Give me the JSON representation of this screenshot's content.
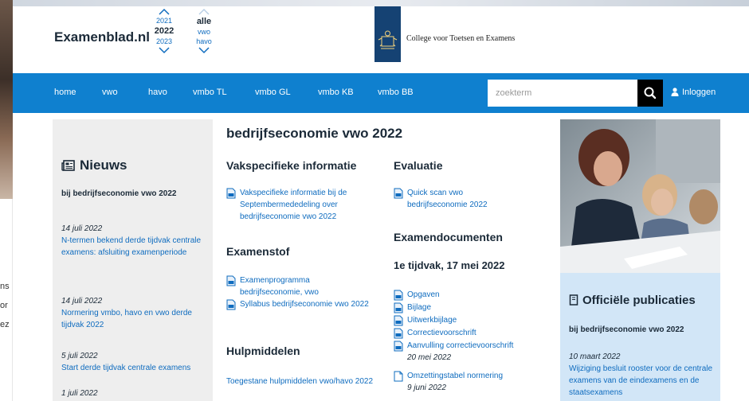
{
  "background": {
    "left_text": [
      "ns",
      "or",
      "ez"
    ]
  },
  "header": {
    "logo": "Examenblad.nl",
    "years": [
      "2021",
      "2022",
      "2023"
    ],
    "levels": [
      "alle",
      "vwo",
      "havo"
    ],
    "org_name": "College voor Toetsen en Examens"
  },
  "nav": {
    "items": [
      "home",
      "vwo",
      "havo",
      "vmbo TL",
      "vmbo GL",
      "vmbo KB",
      "vmbo BB"
    ],
    "search_placeholder": "zoekterm",
    "login": "Inloggen"
  },
  "news": {
    "heading": "Nieuws",
    "subheading": "bij bedrijfseconomie vwo 2022",
    "items": [
      {
        "date": "14 juli 2022",
        "title": "N-termen bekend derde tijdvak centrale examens: afsluiting examenperiode"
      },
      {
        "date": "14 juli 2022",
        "title": "Normering vmbo, havo en vwo derde tijdvak 2022"
      },
      {
        "date": "5 juli 2022",
        "title": "Start derde tijdvak centrale examens"
      },
      {
        "date": "1 juli 2022",
        "title": ""
      }
    ]
  },
  "main": {
    "title": "bedrijfseconomie vwo 2022",
    "vakspecifiek": {
      "heading": "Vakspecifieke informatie",
      "docs": [
        "Vakspecifieke informatie bij de Septembermededeling over bedrijfseconomie vwo 2022"
      ]
    },
    "examenstof": {
      "heading": "Examenstof",
      "docs": [
        "Examenprogramma bedrijfseconomie, vwo",
        "Syllabus bedrijfseconomie vwo 2022"
      ]
    },
    "hulpmiddelen": {
      "heading": "Hulpmiddelen",
      "link": "Toegestane hulpmiddelen vwo/havo 2022"
    },
    "evaluatie": {
      "heading": "Evaluatie",
      "docs": [
        "Quick scan vwo bedrijfseconomie 2022"
      ]
    },
    "examendocumenten": {
      "heading": "Examendocumenten",
      "tijdvak": "1e tijdvak, 17 mei 2022",
      "docs": [
        {
          "label": "Opgaven",
          "date": ""
        },
        {
          "label": "Bijlage",
          "date": ""
        },
        {
          "label": "Uitwerkbijlage",
          "date": ""
        },
        {
          "label": "Correctievoorschrift",
          "date": ""
        },
        {
          "label": "Aanvulling correctievoorschrift",
          "date": "20 mei 2022"
        },
        {
          "label": "Omzettingstabel normering",
          "date": "9 juni 2022"
        }
      ]
    }
  },
  "official": {
    "heading": "Officiële publicaties",
    "subheading": "bij bedrijfseconomie vwo 2022",
    "item_date": "10 maart 2022",
    "item_title": "Wijziging besluit rooster voor de centrale examens van de eindexamens en de staatsexamens"
  },
  "colors": {
    "nav_bg": "#0f80cf",
    "link": "#0f6cbf",
    "news_bg": "#eeeeee",
    "official_bg": "#d2e6f7",
    "crest_bg": "#154273"
  }
}
